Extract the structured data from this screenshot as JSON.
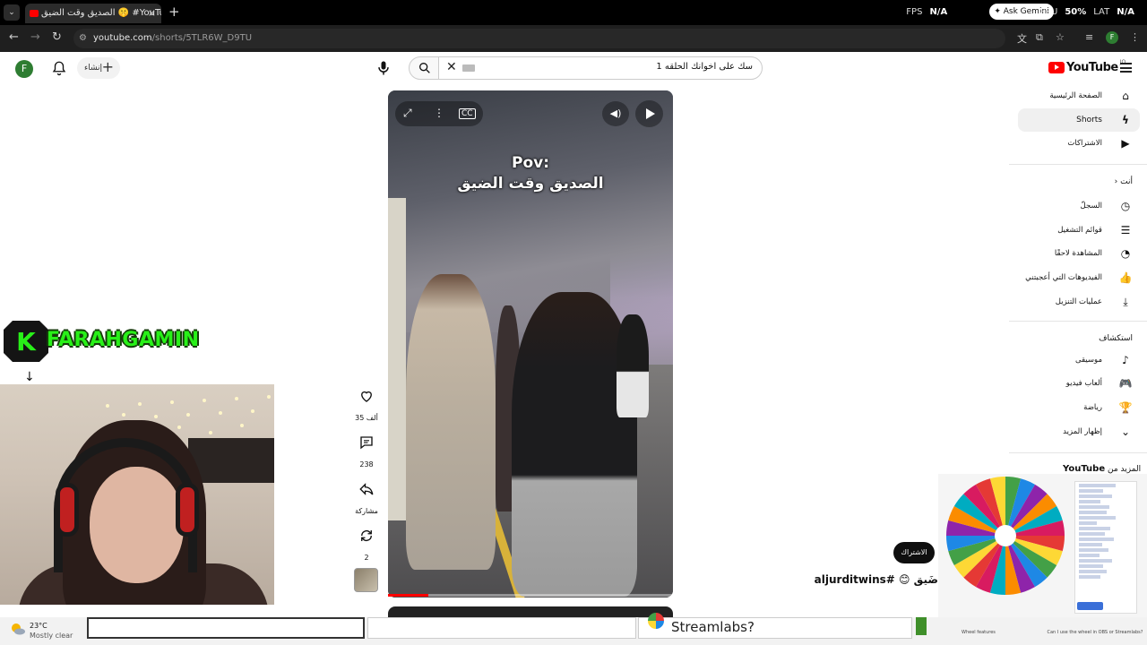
{
  "browser": {
    "tab_title": "الصديق وقت الضيق 🤫 #YouTube",
    "tab_close": "×",
    "new_tab": "+",
    "url_host": "youtube.com",
    "url_path": "/shorts/5TLR6W_D9TU",
    "gemini_label": "Ask Gemini"
  },
  "overlay_stats": {
    "fps_label": "FPS",
    "fps_value": "N/A",
    "gpu_label": "GPU",
    "gpu_value": "50%",
    "lat_label": "LAT",
    "lat_value": "N/A"
  },
  "youtube": {
    "avatar_letter": "F",
    "create_label": "إنشاء",
    "search_query": "سك على اخوانك الحلقه 1",
    "logo_text": "YouTube",
    "logo_region": "JO",
    "sidebar": {
      "home": "الصفحة الرئيسية",
      "shorts": "Shorts",
      "subscriptions": "الاشتراكات",
      "you_heading": "أنت",
      "history": "السجلّ",
      "playlists": "قوائم التشغيل",
      "watch_later": "المشاهدة لاحقًا",
      "liked": "الفيديوهات التي أعجبتني",
      "downloads": "عمليات التنزيل",
      "explore_heading": "استكشاف",
      "music": "موسيقى",
      "gaming": "ألعاب فيديو",
      "sports": "رياضة",
      "show_more": "إظهار المزيد",
      "more_from_prefix": "المزيد من",
      "more_from_brand": "YouTube"
    },
    "short": {
      "caption_line1": "Pov:",
      "caption_line2": "الصديق وقت الضيق",
      "likes": "35 ألف",
      "comments": "238",
      "share": "مشاركة",
      "remix": "2",
      "subscribe": "الاشتراك",
      "title": "ضَيق 😊 #aljurditwins",
      "progress": 0.14
    }
  },
  "stream": {
    "logo_letter": "K",
    "channel_name": "FARAHGAMIN"
  },
  "taskbar": {
    "temp": "23°C",
    "condition": "Mostly clear",
    "streamlabs": "Streamlabs?",
    "wheel_features": "Wheel features",
    "wheel_question": "Can I use the wheel in OBS or Streamlabs?"
  },
  "colors": {
    "youtube_red": "#ff0000",
    "stream_green": "#28f018",
    "avatar_green": "#2e7d32"
  }
}
